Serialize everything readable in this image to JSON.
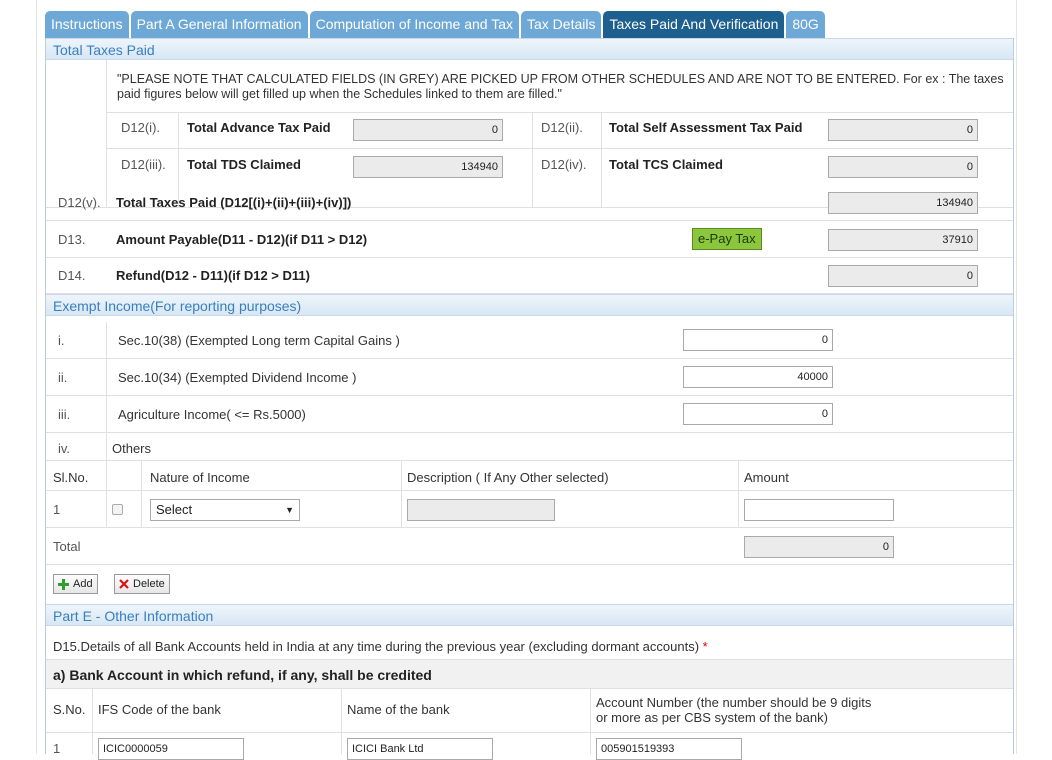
{
  "tabs": [
    "Instructions",
    "Part A General Information",
    "Computation of Income and Tax",
    "Tax Details",
    "Taxes Paid And Verification",
    "80G"
  ],
  "active_tab": "Taxes Paid And Verification",
  "total_taxes": {
    "title": "Total Taxes Paid",
    "note": "\"PLEASE NOTE THAT CALCULATED FIELDS (IN GREY) ARE PICKED UP FROM OTHER SCHEDULES AND ARE NOT TO BE ENTERED. For ex : The taxes paid figures below will get filled up when the Schedules linked to them are filled.\"",
    "d12i": {
      "code": "D12(i).",
      "label": "Total Advance Tax Paid",
      "value": "0"
    },
    "d12ii": {
      "code": "D12(ii).",
      "label": "Total Self Assessment Tax Paid",
      "value": "0"
    },
    "d12iii": {
      "code": "D12(iii).",
      "label": "Total TDS Claimed",
      "value": "134940"
    },
    "d12iv": {
      "code": "D12(iv).",
      "label": "Total TCS Claimed",
      "value": "0"
    },
    "d12v": {
      "code": "D12(v).",
      "label": "Total Taxes Paid (D12[(i)+(ii)+(iii)+(iv)])",
      "value": "134940"
    },
    "d13": {
      "code": "D13.",
      "label": "Amount Payable(D11 - D12)(if D11 > D12)",
      "value": "37910",
      "button": "e-Pay Tax"
    },
    "d14": {
      "code": "D14.",
      "label": "Refund(D12 - D11)(if D12 > D11)",
      "value": "0"
    }
  },
  "exempt": {
    "title": "Exempt Income(For reporting purposes)",
    "rows": [
      {
        "code": "i.",
        "label": "Sec.10(38) (Exempted Long term Capital Gains )",
        "value": "0"
      },
      {
        "code": "ii.",
        "label": "Sec.10(34) (Exempted Dividend Income )",
        "value": "40000"
      },
      {
        "code": "iii.",
        "label": "Agriculture Income( <= Rs.5000)",
        "value": "0"
      }
    ],
    "others_code": "iv.",
    "others_label": "Others",
    "headers": {
      "slno": "Sl.No.",
      "nature": "Nature of Income",
      "desc": "Description ( If Any Other selected)",
      "amount": "Amount"
    },
    "item": {
      "slno": "1",
      "nature": "Select",
      "desc": "",
      "amount": ""
    },
    "total_label": "Total",
    "total_value": "0",
    "add_label": "Add",
    "delete_label": "Delete"
  },
  "part_e": {
    "title": "Part E - Other Information",
    "d15": "D15.Details of all Bank Accounts held in India at any time during the previous year (excluding dormant accounts)",
    "required_mark": "*",
    "sub_title": "a) Bank Account in which refund, if any, shall be credited",
    "headers": {
      "sno": "S.No.",
      "ifs": "IFS Code of the bank",
      "bank": "Name of the bank",
      "acct_line1": "Account Number (the number should be 9 digits",
      "acct_line2": "or more as per CBS system of the bank)"
    },
    "row": {
      "sno": "1",
      "ifs": "ICIC0000059",
      "bank": "ICICI Bank Ltd",
      "account": "005901519393"
    }
  },
  "colors": {
    "tab": "#6ea8d6",
    "tab_active": "#1d5f8e",
    "section_title": "#3a7fbd",
    "epay": "#8cc63f"
  }
}
